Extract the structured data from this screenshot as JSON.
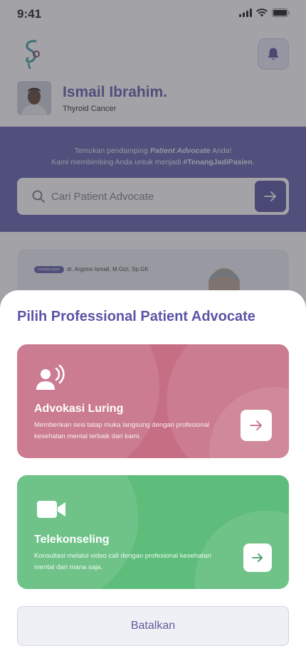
{
  "status_bar": {
    "time": "9:41"
  },
  "header": {
    "user_name": "Ismail Ibrahim.",
    "condition": "Thyroid Cancer"
  },
  "banner": {
    "line1_prefix": "Temukan pendamping ",
    "line1_em": "Patient Advocate",
    "line1_suffix": " Anda!",
    "line2_prefix": "Kami membimbing Anda untuk menjadi ",
    "line2_tag": "#TenangJadiPasien",
    "line2_suffix": "."
  },
  "search": {
    "placeholder": "Cari Patient Advocate"
  },
  "advocate_preview": {
    "badge": "PASIEN ANDA",
    "name": "dr. Argono Ismail, M.Gizi, Sp.GK"
  },
  "sheet": {
    "title": "Pilih Professional Patient Advocate",
    "options": [
      {
        "title": "Advokasi Luring",
        "description": "Memberikan sesi tatap muka langsung dengan profesional kesehatan mental terbaik dari kami.",
        "icon": "person-speaking-icon",
        "color": "#c66e84"
      },
      {
        "title": "Telekonseling",
        "description": "Konsultasi melalui video call dengan profesional kesehatan mental dari mana saja.",
        "icon": "video-camera-icon",
        "color": "#5fbd7c"
      }
    ],
    "cancel_label": "Batalkan"
  },
  "colors": {
    "primary": "#5d5ba8",
    "luring": "#c66e84",
    "tele": "#5fbd7c"
  }
}
